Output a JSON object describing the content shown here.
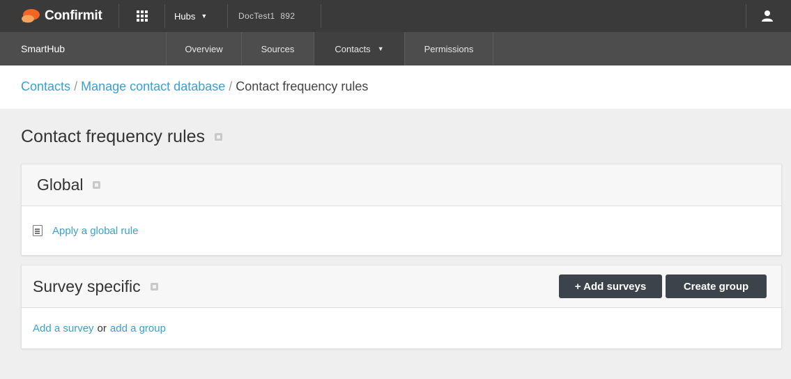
{
  "topbar": {
    "logo_text": "Confirmit",
    "hubs_label": "Hubs",
    "doc_name": "DocTest1",
    "doc_id": "892"
  },
  "nav": {
    "brand": "SmartHub",
    "tabs": [
      {
        "label": "Overview"
      },
      {
        "label": "Sources"
      },
      {
        "label": "Contacts"
      },
      {
        "label": "Permissions"
      }
    ]
  },
  "breadcrumb": {
    "items": [
      "Contacts",
      "Manage contact database"
    ],
    "current": "Contact frequency rules",
    "separator": "/"
  },
  "page": {
    "title": "Contact frequency rules"
  },
  "global_panel": {
    "title": "Global",
    "link": "Apply a global rule"
  },
  "survey_panel": {
    "title": "Survey specific",
    "add_surveys_button": "+ Add surveys",
    "create_group_button": "Create group",
    "empty_link_survey": "Add a survey",
    "empty_or": "or",
    "empty_link_group": "add a group"
  },
  "colors": {
    "topbar": "#3a3a3a",
    "navbar": "#4d4d4d",
    "link": "#3aa0d1",
    "button": "#3d434a",
    "logo_accent": "#f26522"
  },
  "icons": [
    "confirmit-logo-icon",
    "apps-grid-icon",
    "chevron-down-icon",
    "user-icon",
    "help-icon",
    "document-icon"
  ]
}
